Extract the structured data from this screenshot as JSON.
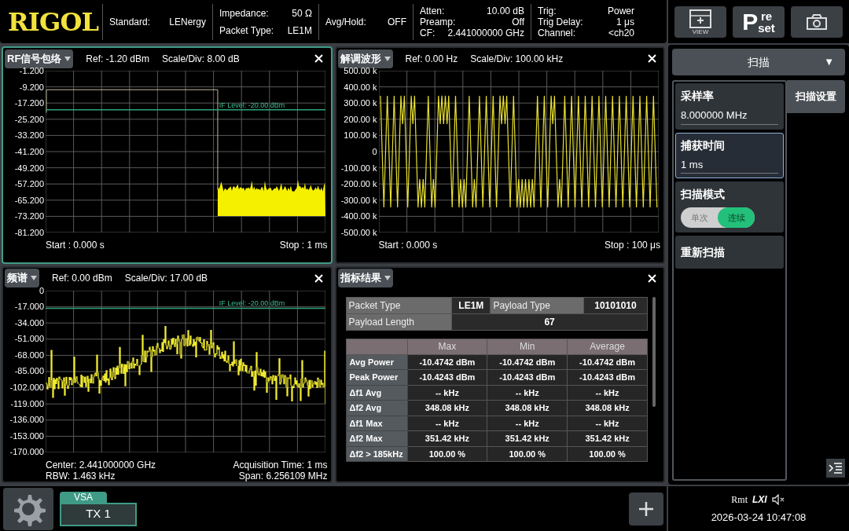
{
  "header": {
    "logo": "RIGOL",
    "groups": [
      [
        {
          "label": "Standard:",
          "value": "LENergy"
        }
      ],
      [
        {
          "label": "Impedance:",
          "value": "50 Ω"
        },
        {
          "label": "Packet Type:",
          "value": "LE1M"
        }
      ],
      [
        {
          "label": "Avg/Hold:",
          "value": "OFF"
        }
      ],
      [
        {
          "label": "Atten:",
          "value": "10.00 dB"
        },
        {
          "label": "Preamp:",
          "value": "Off"
        },
        {
          "label": "CF:",
          "value": "2.441000000 GHz"
        }
      ],
      [
        {
          "label": "Trig:",
          "value": "Power"
        },
        {
          "label": "Trig Delay:",
          "value": "1 μs"
        },
        {
          "label": "Channel:",
          "value": "<ch20"
        }
      ]
    ]
  },
  "toolbar": {
    "view_label": "VIEW",
    "preset": {
      "big": "P",
      "top": "re",
      "bottom": "set"
    }
  },
  "panels": [
    {
      "kind": "envelope",
      "selected": true,
      "title": "RF信号包络",
      "ref": "Ref: -1.20 dBm",
      "scale": "Scale/Div: 8.00 dB",
      "if_level": "IF Level: -20.00 dBm",
      "y_ticks": [
        "-1.200",
        "-9.200",
        "-17.200",
        "-25.200",
        "-33.200",
        "-41.200",
        "-49.200",
        "-57.200",
        "-65.200",
        "-73.200",
        "-81.200"
      ],
      "footer": [
        {
          "left": "Start : 0.000 s",
          "right": "Stop : 1 ms"
        }
      ]
    },
    {
      "kind": "demod",
      "selected": false,
      "title": "解调波形",
      "ref": "Ref: 0.00 Hz",
      "scale": "Scale/Div: 100.00 kHz",
      "y_ticks": [
        "500.00 k",
        "400.00 k",
        "300.00 k",
        "200.00 k",
        "100.00 k",
        "0",
        "-100.00 k",
        "-200.00 k",
        "-300.00 k",
        "-400.00 k",
        "-500.00 k"
      ],
      "footer": [
        {
          "left": "Start : 0.000 s",
          "right": "Stop : 100 μs"
        }
      ]
    },
    {
      "kind": "spectrum",
      "selected": false,
      "title": "频谱",
      "ref": "Ref: 0.00 dBm",
      "scale": "Scale/Div: 17.00 dB",
      "if_level": "IF Level: -20.00 dBm",
      "y_ticks": [
        "0",
        "-17.000",
        "-34.000",
        "-51.000",
        "-68.000",
        "-85.000",
        "-102.000",
        "-119.000",
        "-136.000",
        "-153.000",
        "-170.000"
      ],
      "footer": [
        {
          "left": "Center: 2.441000000 GHz",
          "right": "Acquisition Time: 1 ms"
        },
        {
          "left": "RBW: 1.463 kHz",
          "right": "Span: 6.256109 MHz"
        }
      ]
    },
    {
      "kind": "results",
      "selected": false,
      "title": "指标结果",
      "info": [
        {
          "cells": [
            {
              "kind": "label",
              "text": "Packet Type"
            },
            {
              "kind": "value",
              "text": "LE1M"
            },
            {
              "kind": "label",
              "text": "Payload Type"
            },
            {
              "kind": "value",
              "text": "10101010"
            }
          ]
        },
        {
          "cells": [
            {
              "kind": "label",
              "text": "Payload Length"
            },
            {
              "kind": "value",
              "text": "67"
            }
          ]
        }
      ],
      "columns": [
        "Max",
        "Min",
        "Average"
      ],
      "rows": [
        {
          "label": "Avg Power",
          "values": [
            "-10.4742 dBm",
            "-10.4742 dBm",
            "-10.4742 dBm"
          ]
        },
        {
          "label": "Peak Power",
          "values": [
            "-10.4243 dBm",
            "-10.4243 dBm",
            "-10.4243 dBm"
          ]
        },
        {
          "label": "Δf1 Avg",
          "values": [
            "-- kHz",
            "-- kHz",
            "-- kHz"
          ]
        },
        {
          "label": "Δf2 Avg",
          "values": [
            "348.08 kHz",
            "348.08 kHz",
            "348.08 kHz"
          ]
        },
        {
          "label": "Δf1 Max",
          "values": [
            "-- kHz",
            "-- kHz",
            "-- kHz"
          ]
        },
        {
          "label": "Δf2 Max",
          "values": [
            "351.42 kHz",
            "351.42 kHz",
            "351.42 kHz"
          ]
        },
        {
          "label": "Δf2 > 185kHz",
          "values": [
            "100.00 %",
            "100.00 %",
            "100.00 %"
          ]
        }
      ]
    }
  ],
  "menu": {
    "title": "扫描",
    "arrow": "▼",
    "tabs": [
      {
        "label": "扫描设置",
        "selected": true
      }
    ],
    "items": [
      {
        "kind": "field",
        "label": "采样率",
        "value": "8.000000 MHz",
        "selected": false
      },
      {
        "kind": "field",
        "label": "捕获时间",
        "value": "1 ms",
        "selected": true
      },
      {
        "kind": "toggle",
        "label": "扫描模式",
        "selected": false,
        "options": [
          {
            "label": "单次",
            "selected": false
          },
          {
            "label": "连续",
            "selected": true
          }
        ]
      },
      {
        "kind": "button",
        "label": "重新扫描",
        "selected": false
      }
    ]
  },
  "bottom_tabs": [
    {
      "group": "VSA",
      "label": "TX 1",
      "selected": true
    }
  ],
  "status": {
    "rmt": "Rmt",
    "lxi": "LXI",
    "datetime": "2026-03-24 10:47:08"
  }
}
